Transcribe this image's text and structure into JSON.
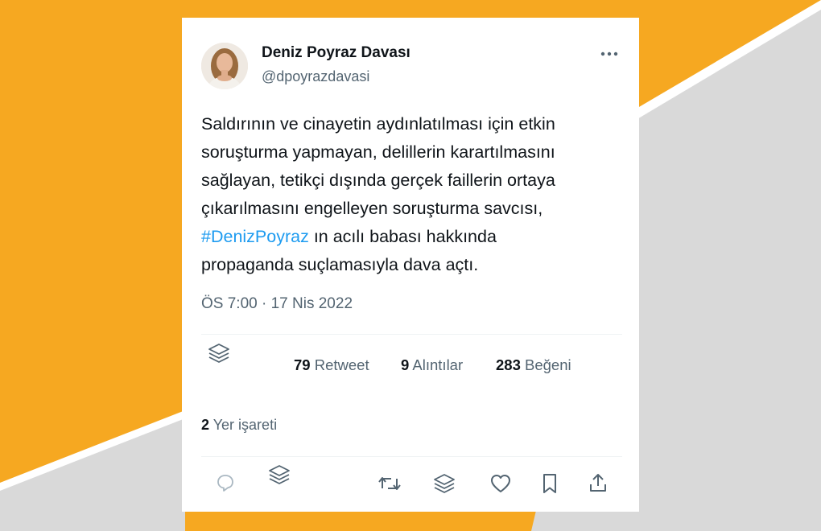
{
  "colors": {
    "orange": "#f6a821",
    "gray": "#d9d9d9",
    "text": "#0f1419",
    "muted": "#536471",
    "link": "#1d9bf0"
  },
  "tweet": {
    "author_name": "Deniz Poyraz Davası",
    "author_handle": "@dpoyrazdavasi",
    "text_lines": [
      "Saldırının ve cinayetin aydınlatılması için etkin",
      "soruşturma yapmayan, delillerin karartılmasını",
      "sağlayan, tetikçi dışında gerçek faillerin ortaya",
      "çıkarılmasını engelleyen soruşturma savcısı,"
    ],
    "hashtag": "#DenizPoyraz",
    "after_hashtag": " ın acılı babası hakkında",
    "last_line": "propaganda suçlamasıyla dava açtı.",
    "time": "ÖS 7:00",
    "separator": " · ",
    "date": "17 Nis 2022"
  },
  "stats": {
    "retweets_count": "79",
    "retweets_label": " Retweet",
    "quotes_count": "9",
    "quotes_label": " Alıntılar",
    "likes_count": "283",
    "likes_label": " Beğeni",
    "bookmarks_count": "2",
    "bookmarks_label": " Yer işareti"
  },
  "icons": {
    "more": "more-dots-icon",
    "reply": "reply-icon",
    "retweet": "retweet-icon",
    "like": "heart-icon",
    "bookmark": "bookmark-icon",
    "share": "share-icon",
    "layers": "layers-icon"
  }
}
